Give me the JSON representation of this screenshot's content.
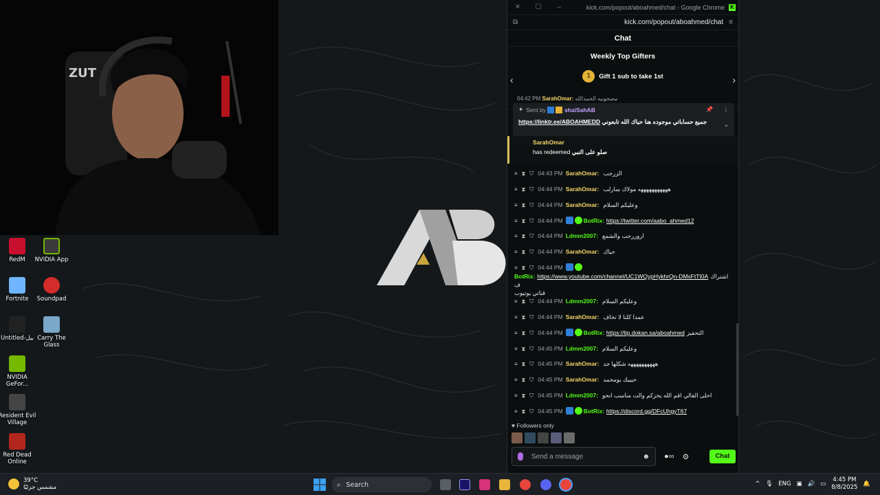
{
  "popup": {
    "window_title": "kick.com/popout/aboahmed/chat - Google Chrome",
    "url": "kick.com/popout/aboahmed/chat",
    "chat_header": "Chat",
    "gifters": {
      "title": "Weekly Top Gifters",
      "rank": "1",
      "text": "Gift 1 sub to take 1st"
    },
    "pinned": {
      "partial_time": "04:42 PM",
      "partial_name": "SarahOmar:",
      "partial_text": "مصحوبيه الحمدالله",
      "sent_by": "Sent by",
      "user": "shaiSahAB",
      "message": "جميع حساباتي موجوده هنا حياك الله تابعوني",
      "link": "https://linktr.ee/ABOAHMEDD"
    },
    "redeem": {
      "user": "SarahOmar",
      "label": "has redeemed",
      "reward": "صلو على النبي"
    },
    "messages": [
      {
        "time": "04:43 PM",
        "user": "SarahOmar:",
        "color": "#f5d86a",
        "text": "الزرجب",
        "link": "",
        "line2": ""
      },
      {
        "time": "04:44 PM",
        "user": "SarahOmar:",
        "color": "#f5d86a",
        "text": "هههههههههههه مولاك سارلب",
        "link": "",
        "line2": ""
      },
      {
        "time": "04:44 PM",
        "user": "SarahOmar:",
        "color": "#f5d86a",
        "text": "وعليكم السلام",
        "link": "",
        "line2": ""
      },
      {
        "time": "04:44 PM",
        "user": "BotRix:",
        "color": "#53fc18",
        "text": "",
        "link": "https://twitter.com/aabo_ahmed12",
        "line2": ""
      },
      {
        "time": "04:44 PM",
        "user": "Ldmm2007:",
        "color": "#53fc18",
        "text": "اروررجب والشمع",
        "link": "",
        "line2": ""
      },
      {
        "time": "04:44 PM",
        "user": "SarahOmar:",
        "color": "#f5d86a",
        "text": "حياك",
        "link": "",
        "line2": ""
      },
      {
        "time": "04:44 PM",
        "user": "BotRix:",
        "color": "#53fc18",
        "text": "اشتراك ف",
        "link": "https://www.youtube.com/channel/UC1WQypHykhrQn-DMxFtTI0A",
        "line2": "قناتي يوتيوب"
      },
      {
        "time": "04:44 PM",
        "user": "Ldmm2007:",
        "color": "#53fc18",
        "text": "وعليكم السلام",
        "link": "",
        "line2": ""
      },
      {
        "time": "04:44 PM",
        "user": "SarahOmar:",
        "color": "#f5d86a",
        "text": "عمدا كلنا لا تخاف",
        "link": "",
        "line2": ""
      },
      {
        "time": "04:44 PM",
        "user": "BotRix:",
        "color": "#53fc18",
        "text": "التحفيز",
        "link": "https://tip.dokan.sa/aboahmed",
        "line2": ""
      },
      {
        "time": "04:45 PM",
        "user": "Ldmm2007:",
        "color": "#53fc18",
        "text": "وعليكم السلام",
        "link": "",
        "line2": ""
      },
      {
        "time": "04:45 PM",
        "user": "SarahOmar:",
        "color": "#f5d86a",
        "text": "ههههههههههه شكلها جد",
        "link": "",
        "line2": ""
      },
      {
        "time": "04:45 PM",
        "user": "SarahOmar:",
        "color": "#f5d86a",
        "text": "حبيبك يومحمد",
        "link": "",
        "line2": ""
      },
      {
        "time": "04:45 PM",
        "user": "Ldmm2007:",
        "color": "#53fc18",
        "text": "احلى الفالي اقم الله يحزكم والت مناسب انحو",
        "link": "",
        "line2": ""
      },
      {
        "time": "04:45 PM",
        "user": "BotRix:",
        "color": "#53fc18",
        "text": "",
        "link": "https://discord.gg/DFcUhgyT67",
        "line2": ""
      }
    ],
    "followers_only": "Followers only",
    "input_placeholder": "Send a message",
    "chat_button": "Chat"
  },
  "desktop_icons": [
    {
      "label": "RedM",
      "color": "#c8102e"
    },
    {
      "label": "NVIDIA App",
      "color": "#3a3a3a"
    },
    {
      "label": "Fortnite",
      "color": "#6fb6ff"
    },
    {
      "label": "Soundpad",
      "color": "#d42b2b"
    },
    {
      "label": "Untitled-بيل",
      "color": "#222222"
    },
    {
      "label": "Carry The Glass",
      "color": "#79a8c8"
    },
    {
      "label": "NVIDIA GeFor...",
      "color": "#76b900"
    },
    {
      "label": "Resident Evil Village",
      "color": "#444444"
    },
    {
      "label": "Red Dead Online",
      "color": "#b3261e"
    }
  ],
  "taskbar": {
    "temp": "39°C",
    "weather": "مشمس جزئيًا",
    "search": "Search",
    "lang": "ENG",
    "time": "4:45 PM",
    "date": "8/8/2025"
  },
  "colors": {
    "kick_green": "#53fc18",
    "accent_gold": "#f5d86a"
  }
}
